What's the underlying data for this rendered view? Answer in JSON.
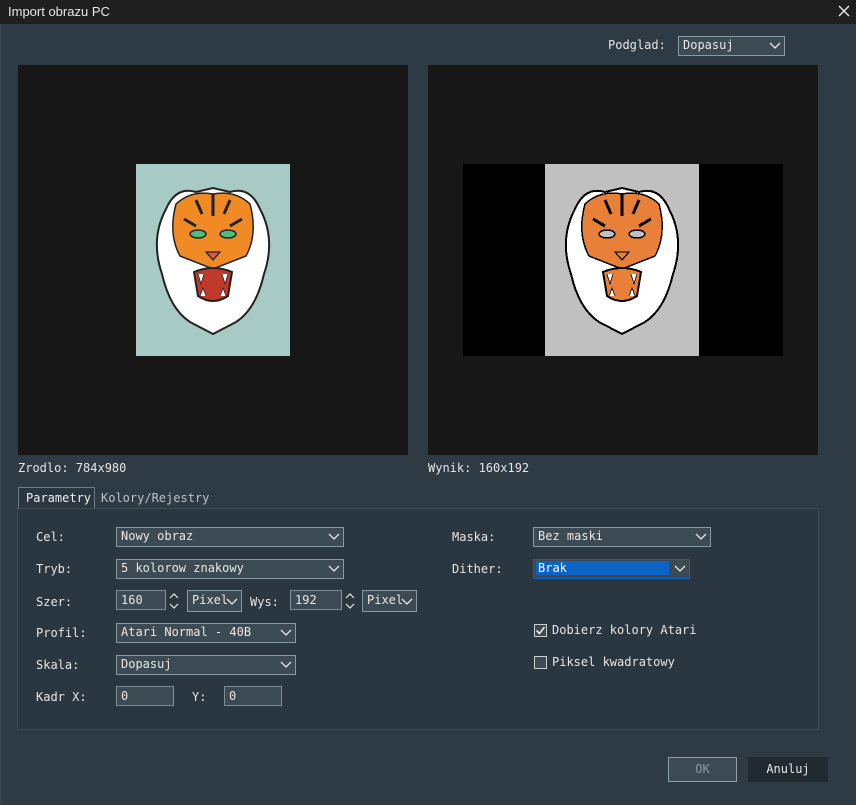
{
  "window": {
    "title": "Import obrazu PC"
  },
  "preview": {
    "label": "Podglad:",
    "value": "Dopasuj"
  },
  "source": {
    "caption": "Zrodlo: 784x980"
  },
  "result": {
    "caption": "Wynik: 160x192"
  },
  "tabs": [
    {
      "label": "Parametry",
      "active": true
    },
    {
      "label": "Kolory/Rejestry",
      "active": false
    }
  ],
  "params": {
    "cel": {
      "label": "Cel:",
      "value": "Nowy obraz"
    },
    "tryb": {
      "label": "Tryb:",
      "value": "5 kolorow znakowy"
    },
    "szer": {
      "label": "Szer:",
      "value": "160",
      "unit": "Pixel"
    },
    "wys": {
      "label": "Wys:",
      "value": "192",
      "unit": "Pixel"
    },
    "profil": {
      "label": "Profil:",
      "value": "Atari Normal - 40B"
    },
    "skala": {
      "label": "Skala:",
      "value": "Dopasuj"
    },
    "kadr": {
      "label": "Kadr X:",
      "x": "0",
      "y_label": "Y:",
      "y": "0"
    },
    "maska": {
      "label": "Maska:",
      "value": "Bez maski"
    },
    "dither": {
      "label": "Dither:",
      "value": "Brak"
    },
    "dobierz": {
      "label": "Dobierz kolory Atari",
      "checked": true
    },
    "piksel": {
      "label": "Piksel kwadratowy",
      "checked": false
    }
  },
  "buttons": {
    "ok": "OK",
    "cancel": "Anuluj"
  },
  "colors": {
    "accent": "#0b63c4",
    "panel_bg": "#171717",
    "source_bg": "#a8cac4",
    "result_bg": "#c0c0c0"
  }
}
